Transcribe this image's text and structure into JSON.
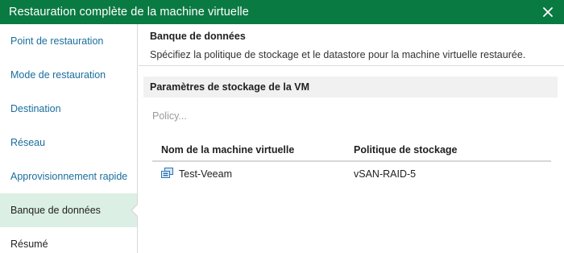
{
  "window": {
    "title": "Restauration complète de la machine virtuelle",
    "accent_color": "#0a7a43"
  },
  "sidebar": {
    "items": [
      {
        "label": "Point de restauration",
        "state": "done"
      },
      {
        "label": "Mode de restauration",
        "state": "done"
      },
      {
        "label": "Destination",
        "state": "done"
      },
      {
        "label": "Réseau",
        "state": "done"
      },
      {
        "label": "Approvisionnement rapide",
        "state": "done"
      },
      {
        "label": "Banque de données",
        "state": "active"
      },
      {
        "label": "Résumé",
        "state": "pending"
      }
    ]
  },
  "header": {
    "title": "Banque de données",
    "description": "Spécifiez la politique de stockage et le datastore pour la machine virtuelle restaurée."
  },
  "main": {
    "section_title": "Paramètres de stockage de la VM",
    "policy_link": "Policy...",
    "table": {
      "columns": [
        "Nom de la machine virtuelle",
        "Politique de stockage"
      ],
      "rows": [
        {
          "icon": "vm-icon",
          "name": "Test-Veeam",
          "policy": "vSAN-RAID-5"
        }
      ]
    }
  }
}
